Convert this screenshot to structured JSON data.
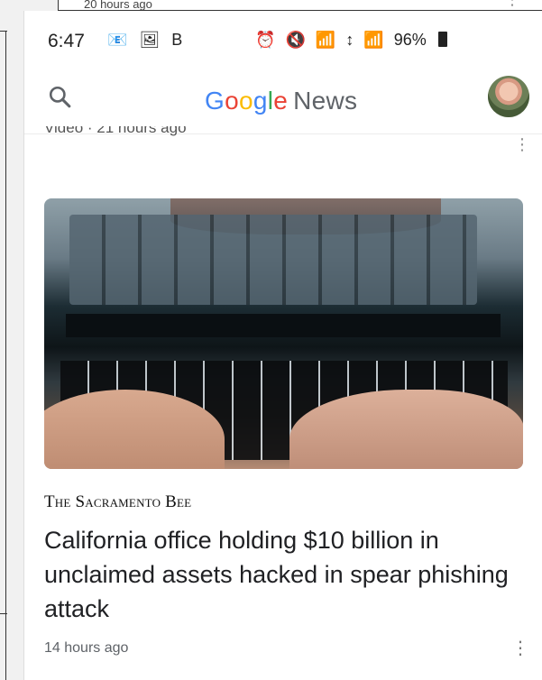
{
  "background_app": {
    "top_text": "20 hours ago",
    "menu_dots": "⋮"
  },
  "status_bar": {
    "time": "6:47",
    "left_icons": "📧 🖼 B",
    "right_icons": [
      "⏰",
      "🔇",
      "📶",
      "↕",
      "📶"
    ],
    "battery": "96%"
  },
  "app_bar": {
    "search_icon": "search-icon",
    "logo": {
      "G": "G",
      "o1": "o",
      "o2": "o",
      "g": "g",
      "l": "l",
      "e": "e",
      "news": "News"
    },
    "avatar_icon": "avatar"
  },
  "feed": {
    "cut_text": "Video · 21 hours ago",
    "cut_menu": "⋮",
    "card": {
      "publisher": "The Sacramento Bee",
      "headline": "California office holding $10 billion in unclaimed assets hacked in spear phishing attack",
      "time": "14 hours ago",
      "menu": "⋮"
    }
  },
  "colors": {
    "google_blue": "#4285F4",
    "google_red": "#EA4335",
    "google_yellow": "#FBBC05",
    "google_green": "#34A853",
    "text_primary": "#202124",
    "text_secondary": "#5f6368"
  }
}
